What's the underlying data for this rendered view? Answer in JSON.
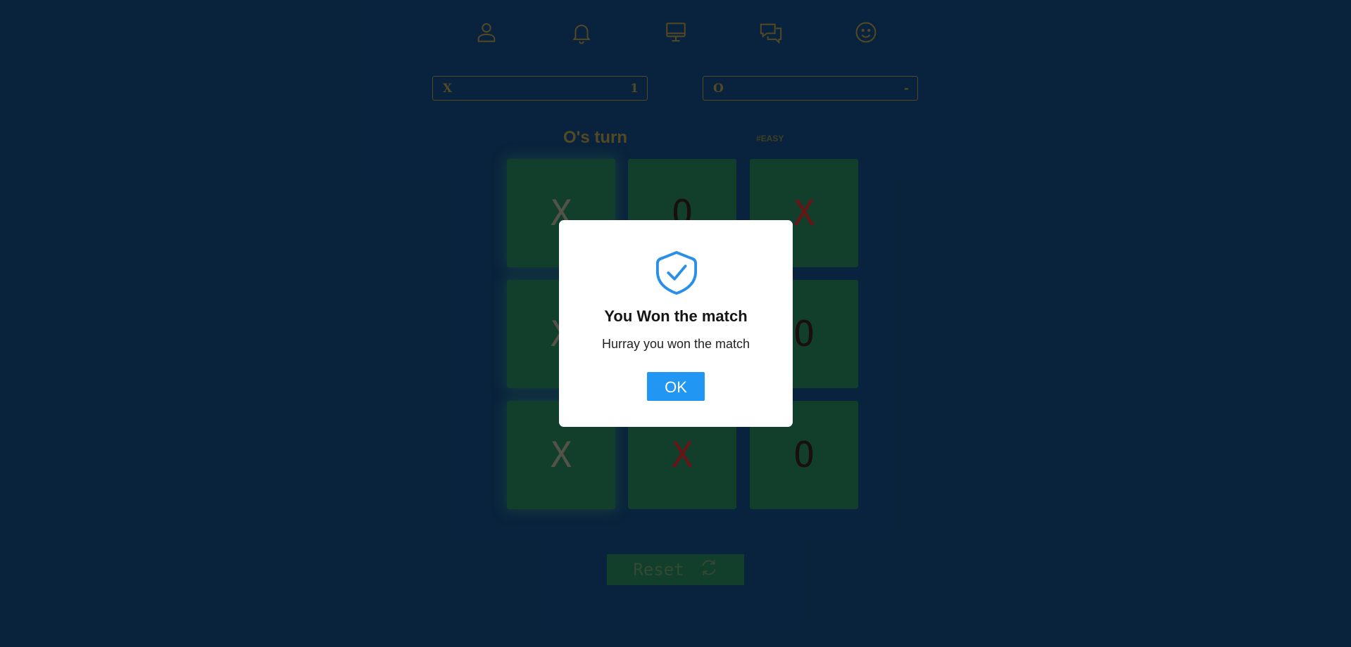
{
  "nav": {
    "items": [
      {
        "icon": "user-icon"
      },
      {
        "icon": "bell-icon"
      },
      {
        "icon": "monitor-icon"
      },
      {
        "icon": "chat-icon"
      },
      {
        "icon": "smiley-icon"
      }
    ]
  },
  "scoreboard": {
    "x": {
      "label": "X",
      "value": "1"
    },
    "o": {
      "label": "O",
      "value": "-"
    }
  },
  "status": {
    "turn": "O's turn",
    "difficulty": "#EASY"
  },
  "board": {
    "cells": [
      "X",
      "O",
      "X",
      "X",
      "",
      "O",
      "X",
      "X",
      "O"
    ]
  },
  "reset": {
    "label": "Reset"
  },
  "modal": {
    "title": "You Won the match",
    "message": "Hurray you won the match",
    "ok_label": "OK"
  },
  "colors": {
    "background": "#0f3a66",
    "cell": "#1e6a4a",
    "accent": "#2196f3",
    "gold": "#8a7a3a",
    "x_red": "#b02424"
  }
}
